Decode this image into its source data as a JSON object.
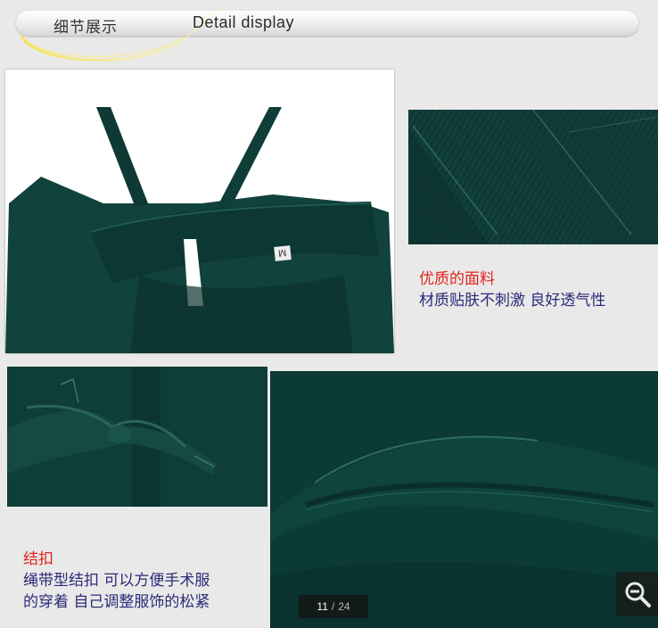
{
  "header": {
    "title_cn": "细节展示",
    "title_en": "Detail display"
  },
  "photos": {
    "collar": {
      "size_label": "M"
    }
  },
  "fabric": {
    "title": "优质的面料",
    "description": "材质贴肤不刺激 良好透气性"
  },
  "button": {
    "title": "结扣",
    "line1": "绳带型结扣 可以方便手术服",
    "line2": "的穿着 自己调整服饰的松紧"
  },
  "viewer": {
    "current_page": "11",
    "separator": "/",
    "total_pages": "24",
    "zoom_icon": "zoom-out-icon"
  },
  "colors": {
    "fabric_green": "#0f3b36",
    "caption_title_red": "#e0241d",
    "caption_text_navy": "#2d2a78"
  }
}
